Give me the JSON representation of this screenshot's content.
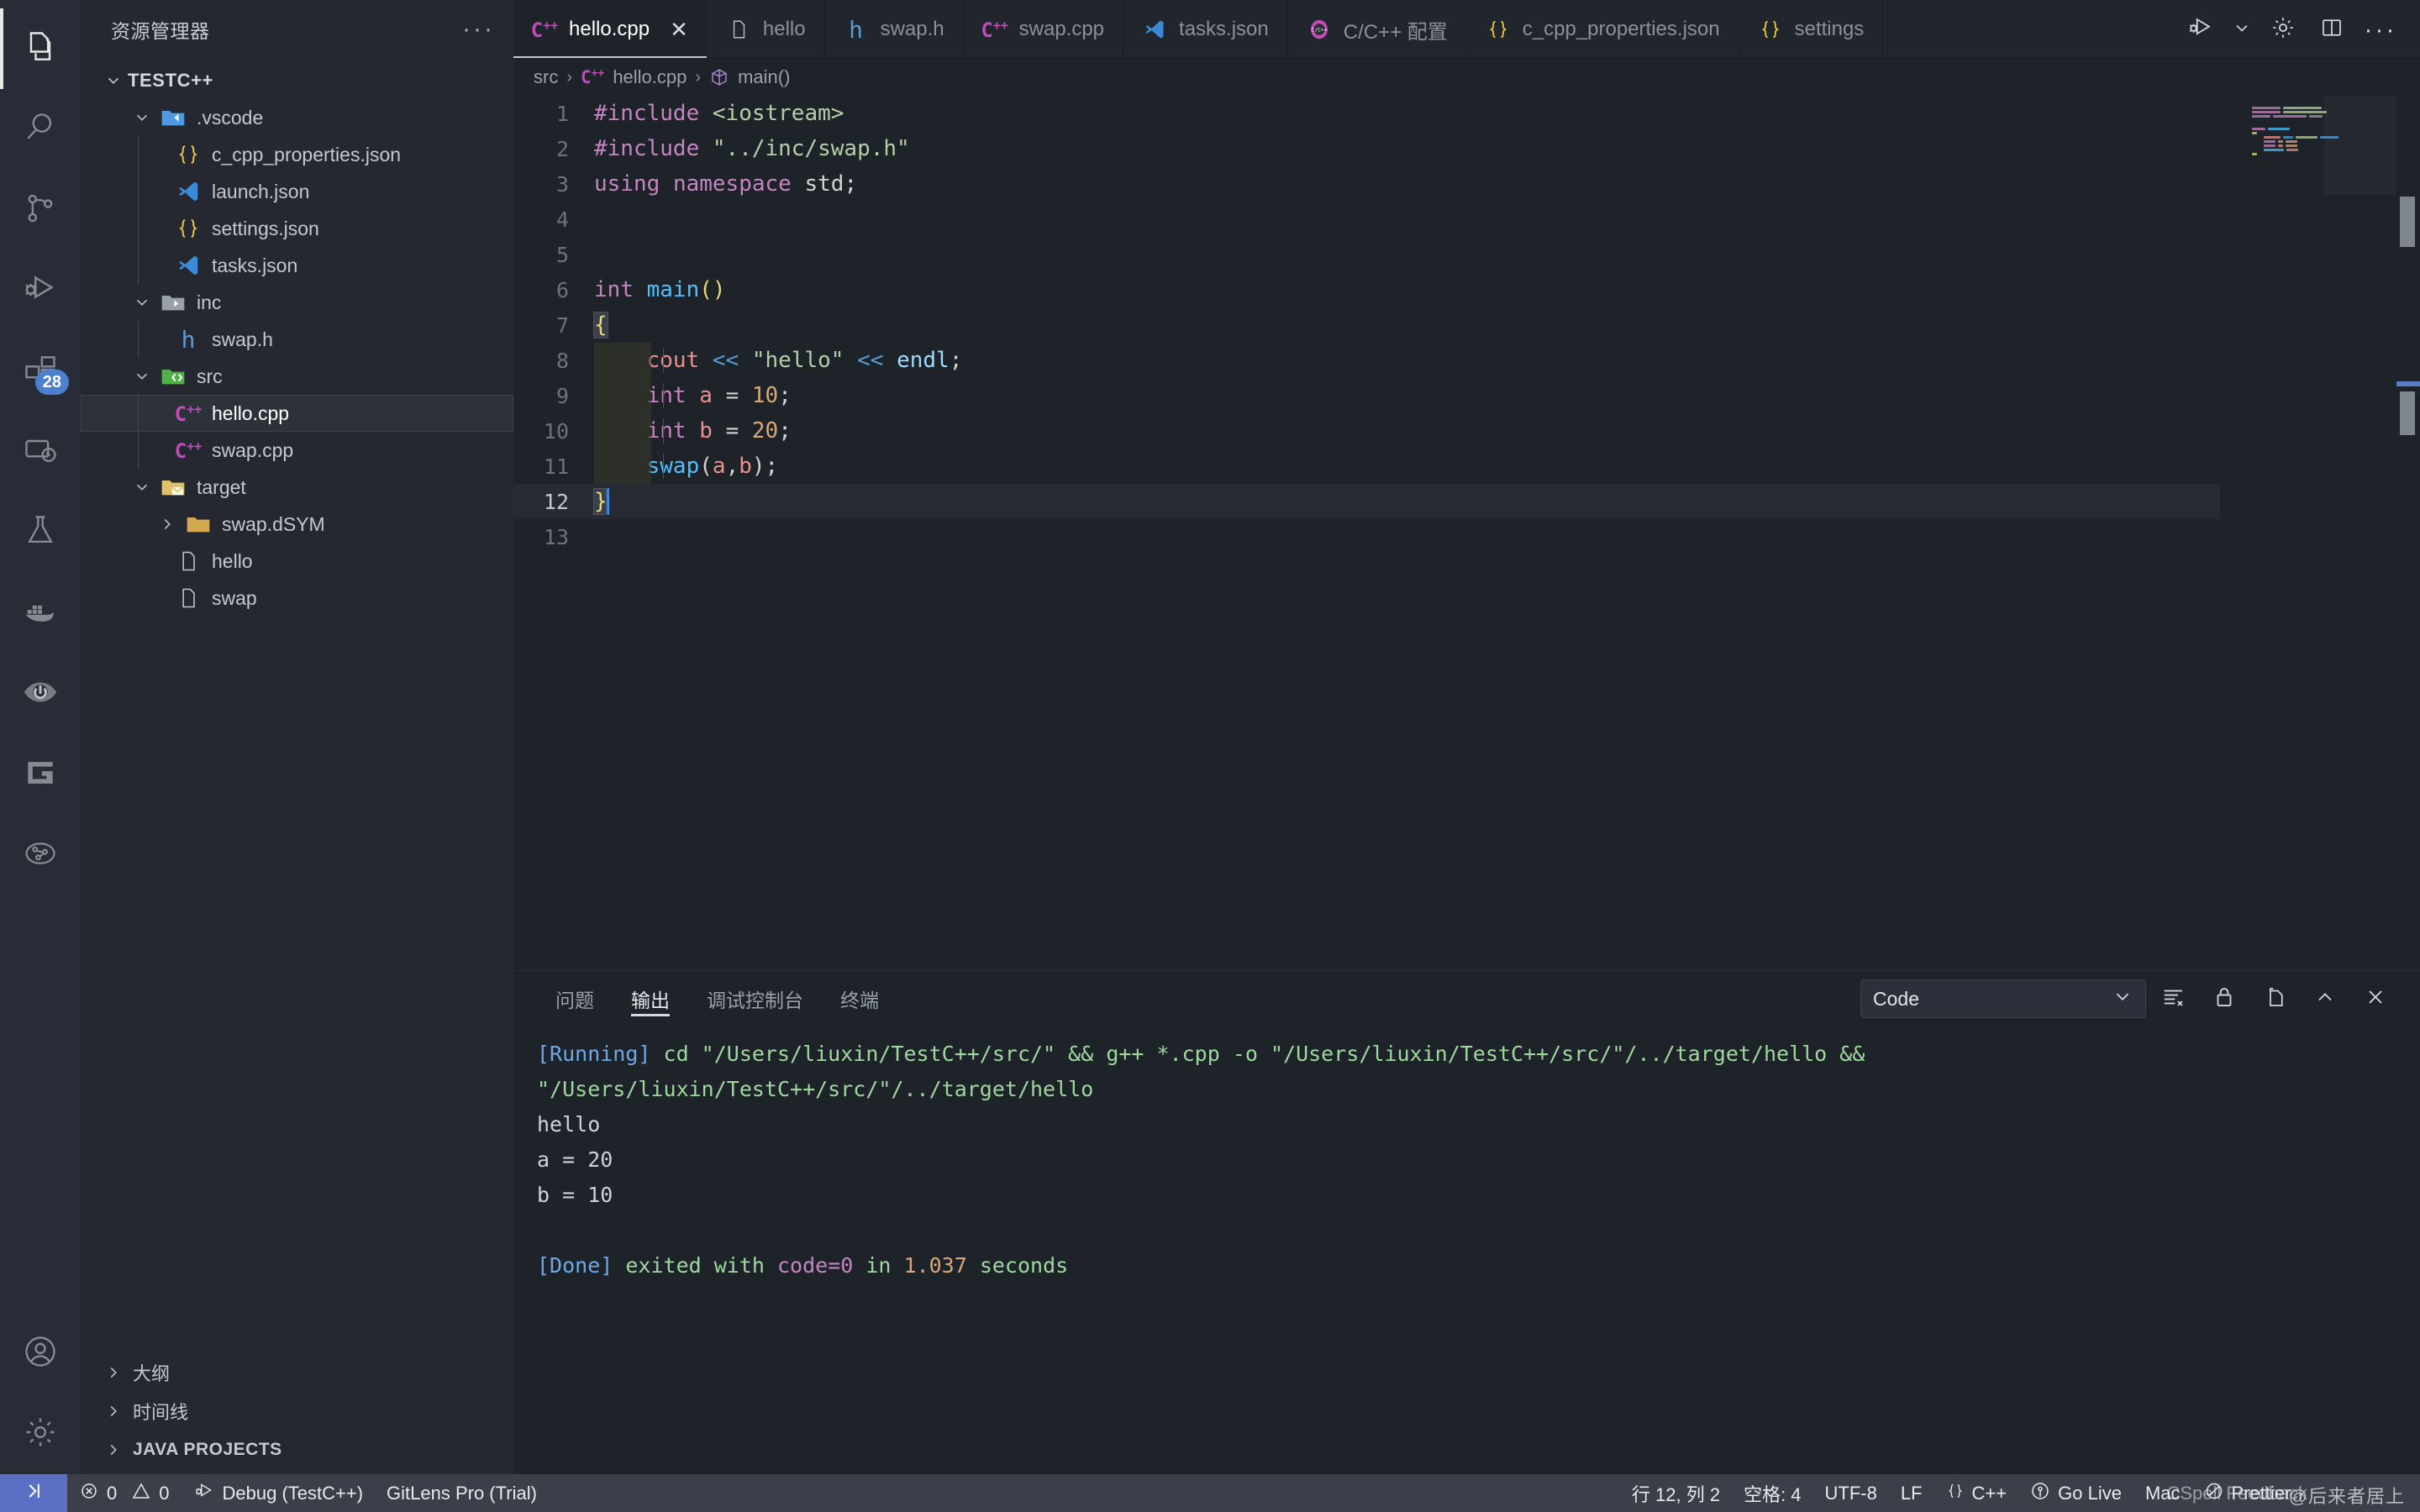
{
  "activitybar": {
    "items": [
      {
        "name": "explorer",
        "icon": "files-icon",
        "active": true
      },
      {
        "name": "search",
        "icon": "search-icon",
        "active": false
      },
      {
        "name": "source-control",
        "icon": "source-control-icon",
        "active": false
      },
      {
        "name": "run-and-debug",
        "icon": "run-debug-icon",
        "active": false
      },
      {
        "name": "extensions",
        "icon": "extensions-icon",
        "active": false,
        "badge": "28"
      },
      {
        "name": "remote-explorer",
        "icon": "remote-icon",
        "active": false
      },
      {
        "name": "testing",
        "icon": "beaker-icon",
        "active": false
      },
      {
        "name": "docker",
        "icon": "docker-icon",
        "active": false
      },
      {
        "name": "live-share",
        "icon": "live-share-icon",
        "active": false
      },
      {
        "name": "gitlens",
        "icon": "gitlens-g-icon",
        "active": false
      },
      {
        "name": "project-manager",
        "icon": "graph-icon",
        "active": false
      }
    ],
    "bottom": [
      {
        "name": "accounts",
        "icon": "account-icon"
      },
      {
        "name": "manage",
        "icon": "gear-icon"
      }
    ]
  },
  "sidebar": {
    "title": "资源管理器",
    "more_label": "···",
    "root": "TESTC++",
    "tree": [
      {
        "label": ".vscode",
        "depth": 1,
        "type": "folder",
        "icon": "folder-vscode-icon",
        "expanded": true
      },
      {
        "label": "c_cpp_properties.json",
        "depth": 2,
        "type": "file",
        "icon": "json-icon"
      },
      {
        "label": "launch.json",
        "depth": 2,
        "type": "file",
        "icon": "vscode-icon"
      },
      {
        "label": "settings.json",
        "depth": 2,
        "type": "file",
        "icon": "json-icon"
      },
      {
        "label": "tasks.json",
        "depth": 2,
        "type": "file",
        "icon": "vscode-icon"
      },
      {
        "label": "inc",
        "depth": 1,
        "type": "folder",
        "icon": "folder-include-icon",
        "expanded": true
      },
      {
        "label": "swap.h",
        "depth": 2,
        "type": "file",
        "icon": "h-icon"
      },
      {
        "label": "src",
        "depth": 1,
        "type": "folder",
        "icon": "folder-src-icon",
        "expanded": true
      },
      {
        "label": "hello.cpp",
        "depth": 2,
        "type": "file",
        "icon": "cpp-icon",
        "selected": true
      },
      {
        "label": "swap.cpp",
        "depth": 2,
        "type": "file",
        "icon": "cpp-icon"
      },
      {
        "label": "target",
        "depth": 1,
        "type": "folder",
        "icon": "folder-target-icon",
        "expanded": true
      },
      {
        "label": "swap.dSYM",
        "depth": 2,
        "type": "folder",
        "icon": "folder-icon",
        "expanded": false
      },
      {
        "label": "hello",
        "depth": 2,
        "type": "file",
        "icon": "blank-file-icon"
      },
      {
        "label": "swap",
        "depth": 2,
        "type": "file",
        "icon": "blank-file-icon"
      }
    ],
    "sections": [
      {
        "label": "大纲",
        "caps": false
      },
      {
        "label": "时间线",
        "caps": false
      },
      {
        "label": "JAVA PROJECTS",
        "caps": true
      }
    ]
  },
  "tabs": [
    {
      "label": "hello.cpp",
      "icon": "cpp-icon",
      "active": true,
      "closable": true,
      "close_label": "✕"
    },
    {
      "label": "hello",
      "icon": "blank-file-icon",
      "active": false
    },
    {
      "label": "swap.h",
      "icon": "h-icon",
      "active": false
    },
    {
      "label": "swap.cpp",
      "icon": "cpp-icon",
      "active": false
    },
    {
      "label": "tasks.json",
      "icon": "vscode-icon",
      "active": false
    },
    {
      "label": "C/C++ 配置",
      "icon": "cpp-config-icon",
      "active": false
    },
    {
      "label": "c_cpp_properties.json",
      "icon": "json-icon",
      "active": false
    },
    {
      "label": "settings",
      "icon": "json-icon",
      "active": false
    }
  ],
  "editor_actions": [
    {
      "name": "run-debug-button",
      "icon": "run-debug-icon"
    },
    {
      "name": "run-debug-dropdown",
      "icon": "chevron-down-icon"
    },
    {
      "name": "cpp-config-button",
      "icon": "gear-icon"
    },
    {
      "name": "split-editor-button",
      "icon": "split-editor-icon"
    },
    {
      "name": "more-actions-button",
      "icon": "ellipsis-icon",
      "label": "···"
    }
  ],
  "breadcrumb": {
    "items": [
      "src",
      "hello.cpp",
      "main()"
    ],
    "separator": "›"
  },
  "code": {
    "language": "cpp",
    "lines": [
      {
        "n": "1",
        "text": "#include <iostream>"
      },
      {
        "n": "2",
        "text": "#include \"../inc/swap.h\""
      },
      {
        "n": "3",
        "text": "using namespace std;"
      },
      {
        "n": "4",
        "text": ""
      },
      {
        "n": "5",
        "text": ""
      },
      {
        "n": "6",
        "text": "int main()"
      },
      {
        "n": "7",
        "text": "{"
      },
      {
        "n": "8",
        "text": "    cout << \"hello\" << endl;"
      },
      {
        "n": "9",
        "text": "    int a = 10;"
      },
      {
        "n": "10",
        "text": "    int b = 20;"
      },
      {
        "n": "11",
        "text": "    swap(a,b);"
      },
      {
        "n": "12",
        "text": "}"
      },
      {
        "n": "13",
        "text": ""
      }
    ]
  },
  "panel": {
    "tabs": [
      {
        "label": "问题",
        "active": false
      },
      {
        "label": "输出",
        "active": true
      },
      {
        "label": "调试控制台",
        "active": false
      },
      {
        "label": "终端",
        "active": false
      }
    ],
    "channel": "Code",
    "channel_chevron": "⌄",
    "actions": [
      {
        "name": "clear-output-button",
        "icon": "clear-output-icon"
      },
      {
        "name": "lock-scroll-button",
        "icon": "lock-icon"
      },
      {
        "name": "open-in-editor-button",
        "icon": "open-in-editor-icon"
      },
      {
        "name": "collapse-panel-button",
        "icon": "chevron-up-icon"
      },
      {
        "name": "close-panel-button",
        "icon": "close-icon"
      }
    ],
    "output": {
      "running_tag": "[Running]",
      "running_cmd": " cd \"/Users/liuxin/TestC++/src/\" && g++ *.cpp -o \"/Users/liuxin/TestC++/src/\"/../target/hello && \"/Users/liuxin/TestC++/src/\"/../target/hello",
      "stdout": [
        "hello",
        "a = 20",
        "b = 10",
        ""
      ],
      "done_tag": "[Done]",
      "done_mid1": " exited with ",
      "done_code": "code=0",
      "done_mid2": " in ",
      "done_time": "1.037",
      "done_suffix": " seconds"
    }
  },
  "statusbar": {
    "remote_icon": "remote-window-icon",
    "errors": "0",
    "warnings": "0",
    "debug_label": "Debug (TestC++)",
    "gitlens": "GitLens Pro (Trial)",
    "position": "行 12, 列 2",
    "indent": "空格: 4",
    "encoding": "UTF-8",
    "eol": "LF",
    "language": "C++",
    "golive": "Go Live",
    "platform": "Mac",
    "prettier": "Prettier",
    "feedback": "CSpell Feedback",
    "watermark": "@后来者居上"
  },
  "colors": {
    "accent": "#5b6fc4",
    "badge": "#4d7fcf",
    "cpp_icon": "#bf4db8",
    "json_icon": "#e8c547",
    "vscode_icon": "#3b8ad8",
    "h_icon": "#5b9bd5"
  }
}
